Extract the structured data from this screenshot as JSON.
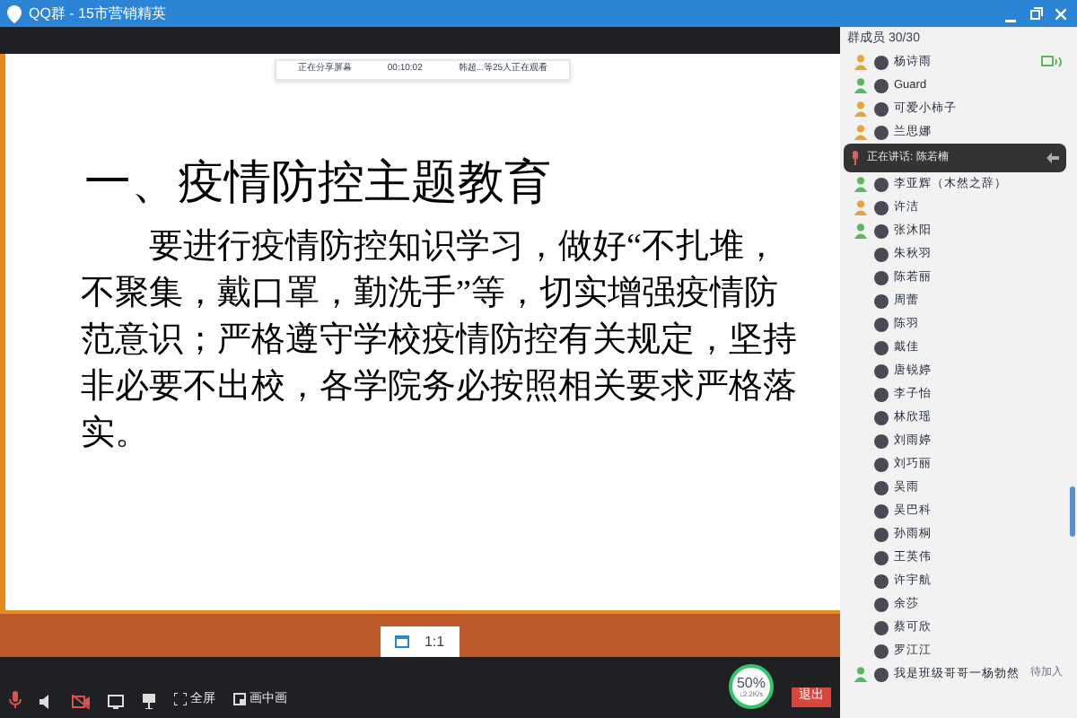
{
  "window": {
    "title": "QQ群 - 15市营销精英"
  },
  "share_banner": {
    "status": "正在分享屏幕",
    "time": "00:10:02",
    "viewers": "韩超...等25人正在观看"
  },
  "slide": {
    "heading": "一、疫情防控主题教育",
    "paragraph": "要进行疫情防控知识学习，做好“不扎堆，不聚集，戴口罩，勤洗手”等，切实增强疫情防范意识；严格遵守学校疫情防控有关规定，坚持非必要不出校，各学院务必按照相关要求严格落实。"
  },
  "zoom_chip": {
    "label": "1:1"
  },
  "toolbar": {
    "mic_muted": true,
    "camera_off": true,
    "fullscreen": "全屏",
    "pip": "画中画",
    "network": {
      "percent": "50%",
      "speed": "↓2.2K/s"
    },
    "exit": "退出"
  },
  "members": {
    "title": "群成员 30/30",
    "speaking": "正在讲话: 陈若楠",
    "items": [
      {
        "name": "杨诗雨",
        "kind": "owner",
        "sharing": true
      },
      {
        "name": "Guard",
        "kind": "admin",
        "sharing": false
      },
      {
        "name": "可爱小柿子",
        "kind": "owner",
        "sharing": false
      },
      {
        "name": "兰思娜",
        "kind": "owner",
        "sharing": false
      },
      {
        "name": "李亚辉（木然之辞）",
        "kind": "admin",
        "sharing": false
      },
      {
        "name": "许洁",
        "kind": "owner",
        "sharing": false
      },
      {
        "name": "张沐阳",
        "kind": "admin",
        "sharing": false
      },
      {
        "name": "朱秋羽",
        "kind": "member",
        "sharing": false
      },
      {
        "name": "陈若丽",
        "kind": "member",
        "sharing": false
      },
      {
        "name": "周蕾",
        "kind": "member",
        "sharing": false
      },
      {
        "name": "陈羽",
        "kind": "member",
        "sharing": false
      },
      {
        "name": "戴佳",
        "kind": "member",
        "sharing": false
      },
      {
        "name": "唐锐婷",
        "kind": "member",
        "sharing": false
      },
      {
        "name": "李子怡",
        "kind": "member",
        "sharing": false
      },
      {
        "name": "林欣瑶",
        "kind": "member",
        "sharing": false
      },
      {
        "name": "刘雨婷",
        "kind": "member",
        "sharing": false
      },
      {
        "name": "刘巧丽",
        "kind": "member",
        "sharing": false
      },
      {
        "name": "吴雨",
        "kind": "member",
        "sharing": false
      },
      {
        "name": "吴巴科",
        "kind": "member",
        "sharing": false
      },
      {
        "name": "孙雨桐",
        "kind": "member",
        "sharing": false
      },
      {
        "name": "王英伟",
        "kind": "member",
        "sharing": false
      },
      {
        "name": "许宇航",
        "kind": "member",
        "sharing": false
      },
      {
        "name": "余莎",
        "kind": "member",
        "sharing": false
      },
      {
        "name": "蔡可欣",
        "kind": "member",
        "sharing": false
      },
      {
        "name": "罗江江",
        "kind": "member",
        "sharing": false
      },
      {
        "name": "我是班级哥哥一杨勃然",
        "kind": "admin",
        "sharing": false,
        "note": "待加入"
      }
    ]
  }
}
